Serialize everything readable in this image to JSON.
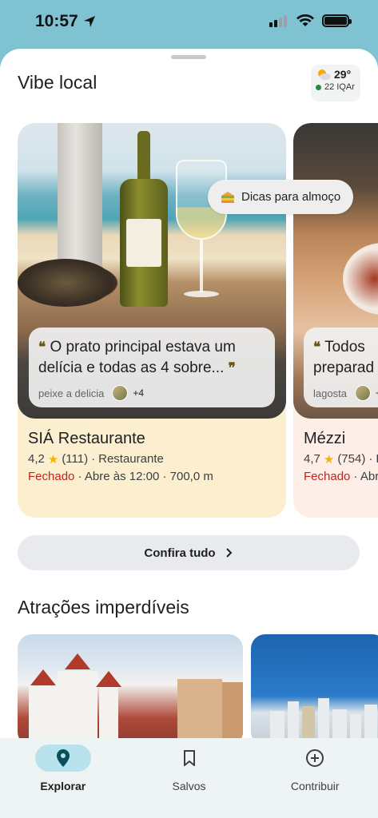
{
  "status_bar": {
    "time": "10:57"
  },
  "header": {
    "title": "Vibe local"
  },
  "weather": {
    "temp": "29°",
    "aqi": "22 IQAr"
  },
  "chip": {
    "label": "Dicas para almoço"
  },
  "cards": [
    {
      "quote": "O prato principal estava um delícia e todas as 4 sobre...",
      "tag": "peixe a delicia",
      "more": "+4",
      "name": "SIÁ Restaurante",
      "rating": "4,2",
      "reviews": "(111)",
      "category": "Restaurante",
      "status": "Fechado",
      "hours": "Abre às 12:00",
      "distance": "700,0 m"
    },
    {
      "quote": "Todos preparad",
      "tag": "lagosta",
      "more": "+",
      "name": "Mézzi",
      "rating": "4,7",
      "reviews": "(754)",
      "category": "R",
      "status": "Fechado",
      "hours": "Abr"
    }
  ],
  "see_all": {
    "label": "Confira tudo"
  },
  "attractions": {
    "title": "Atrações imperdíveis"
  },
  "nav": [
    {
      "label": "Explorar",
      "icon": "location-pin-icon",
      "active": true
    },
    {
      "label": "Salvos",
      "icon": "bookmark-icon",
      "active": false
    },
    {
      "label": "Contribuir",
      "icon": "add-circle-icon",
      "active": false
    }
  ],
  "colors": {
    "accent_pill": "#b8e3ec",
    "closed_red": "#c5221f",
    "card1_bg": "#fbefcf",
    "card2_bg": "#fdeee8",
    "star": "#f4b400"
  }
}
